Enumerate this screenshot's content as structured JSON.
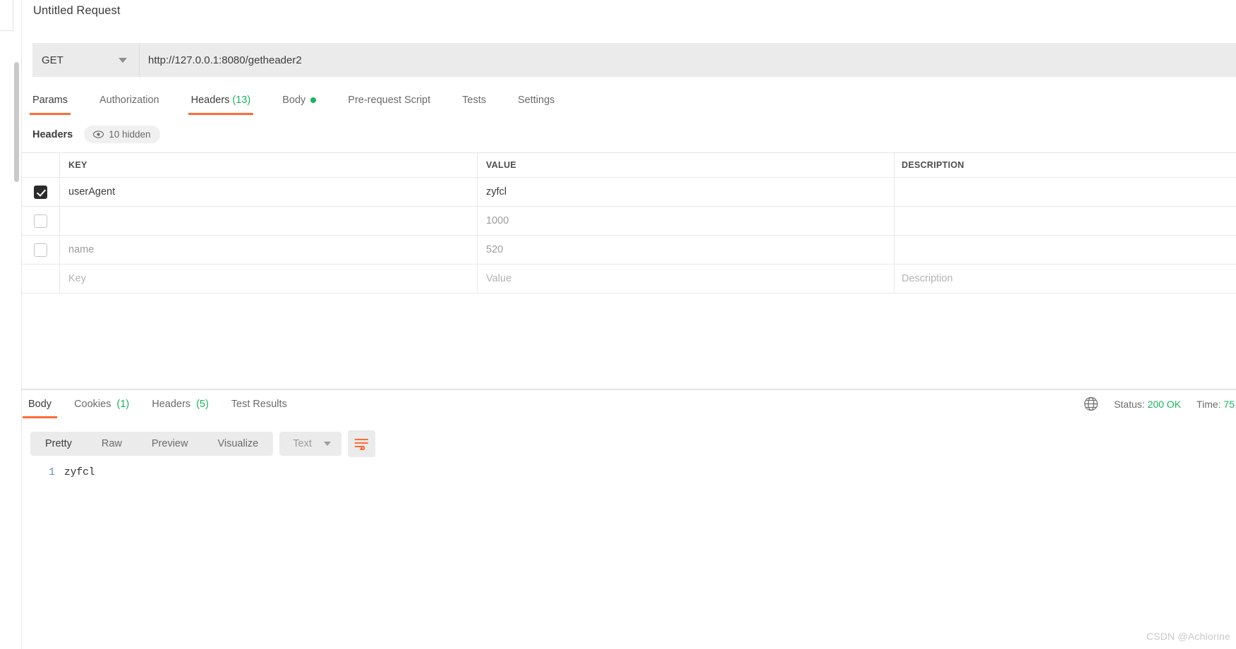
{
  "request": {
    "title": "Untitled Request",
    "method": "GET",
    "url": "http://127.0.0.1:8080/getheader2",
    "tabs": [
      {
        "label": "Params",
        "count": "",
        "active": false
      },
      {
        "label": "Authorization",
        "count": "",
        "active": false
      },
      {
        "label": "Headers",
        "count": "(13)",
        "active": true
      },
      {
        "label": "Body",
        "count": "",
        "active": false,
        "dot": true
      },
      {
        "label": "Pre-request Script",
        "count": "",
        "active": false
      },
      {
        "label": "Tests",
        "count": "",
        "active": false
      },
      {
        "label": "Settings",
        "count": "",
        "active": false
      }
    ]
  },
  "headers_panel": {
    "section_label": "Headers",
    "hidden_pill_label": "10 hidden",
    "eye_icon": "eye-icon",
    "columns": [
      "KEY",
      "VALUE",
      "DESCRIPTION"
    ],
    "rows": [
      {
        "checked": true,
        "key": "userAgent",
        "value": "zyfcl",
        "description": "",
        "muted": false
      },
      {
        "checked": false,
        "key": "",
        "value": "1000",
        "description": "",
        "muted": true
      },
      {
        "checked": false,
        "key": "name",
        "value": "520",
        "description": "",
        "muted": true
      }
    ],
    "new_row": {
      "key_placeholder": "Key",
      "value_placeholder": "Value",
      "description_placeholder": "Description"
    }
  },
  "response": {
    "tabs": [
      {
        "label": "Body",
        "count": "",
        "active": true
      },
      {
        "label": "Cookies",
        "count": "(1)",
        "active": false
      },
      {
        "label": "Headers",
        "count": "(5)",
        "active": false
      },
      {
        "label": "Test Results",
        "count": "",
        "active": false
      }
    ],
    "meta": {
      "globe_icon": "globe-icon",
      "status_label": "Status:",
      "status_value": "200 OK",
      "time_label": "Time:",
      "time_value": "75"
    },
    "view_modes": [
      {
        "label": "Pretty",
        "active": true
      },
      {
        "label": "Raw",
        "active": false
      },
      {
        "label": "Preview",
        "active": false
      },
      {
        "label": "Visualize",
        "active": false
      }
    ],
    "format": "Text",
    "wrap_icon": "word-wrap-icon",
    "body_lines": [
      {
        "n": "1",
        "text": "zyfcl"
      }
    ]
  },
  "watermark": "CSDN @Achlorine",
  "colors": {
    "accent": "#ff6c37",
    "success": "#19b35f",
    "text": "#3c3c3c",
    "muted": "#9c9c9c"
  }
}
